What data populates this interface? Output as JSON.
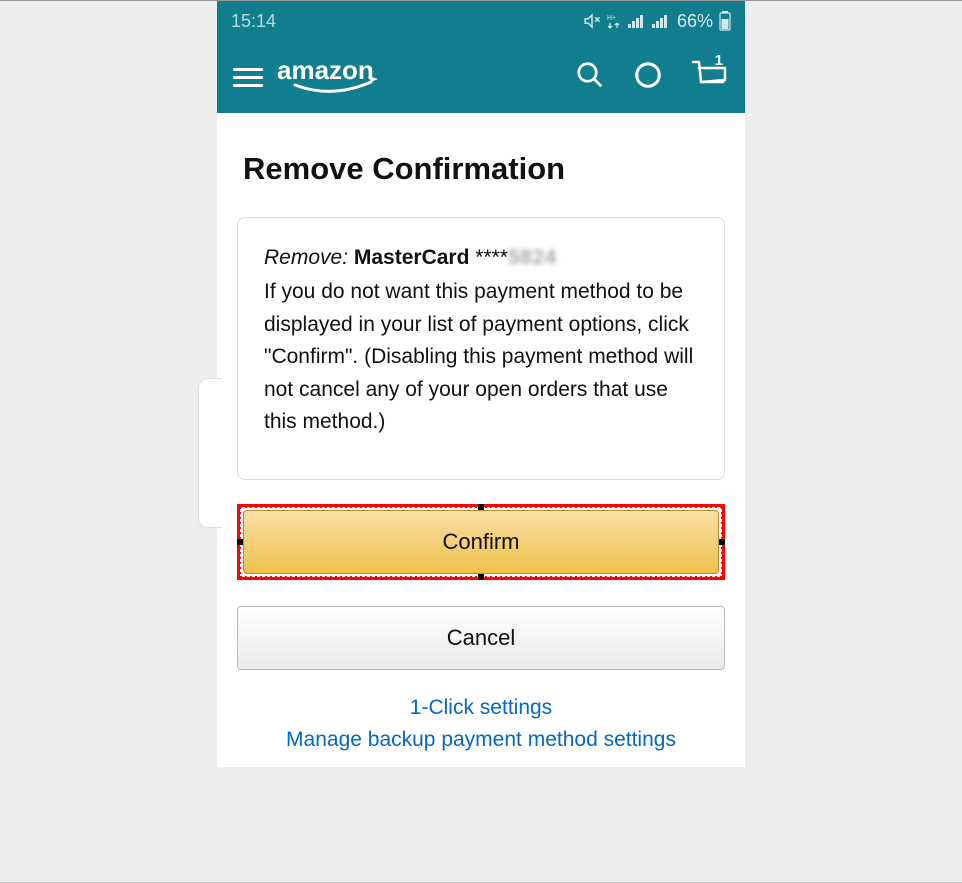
{
  "statusbar": {
    "time": "15:14",
    "battery": "66%"
  },
  "header": {
    "brand": "amazon",
    "cart_count": "1"
  },
  "page": {
    "title": "Remove Confirmation"
  },
  "card": {
    "remove_label": "Remove:",
    "card_type": "MasterCard",
    "mask_prefix": "****",
    "mask_digits": "5824",
    "description": "If you do not want this payment method to be displayed in your list of payment options, click \"Confirm\". (Disabling this payment method will not cancel any of your open orders that use this method.)"
  },
  "buttons": {
    "confirm": "Confirm",
    "cancel": "Cancel"
  },
  "links": {
    "one_click": "1-Click settings",
    "manage_backup": "Manage backup payment method settings"
  }
}
